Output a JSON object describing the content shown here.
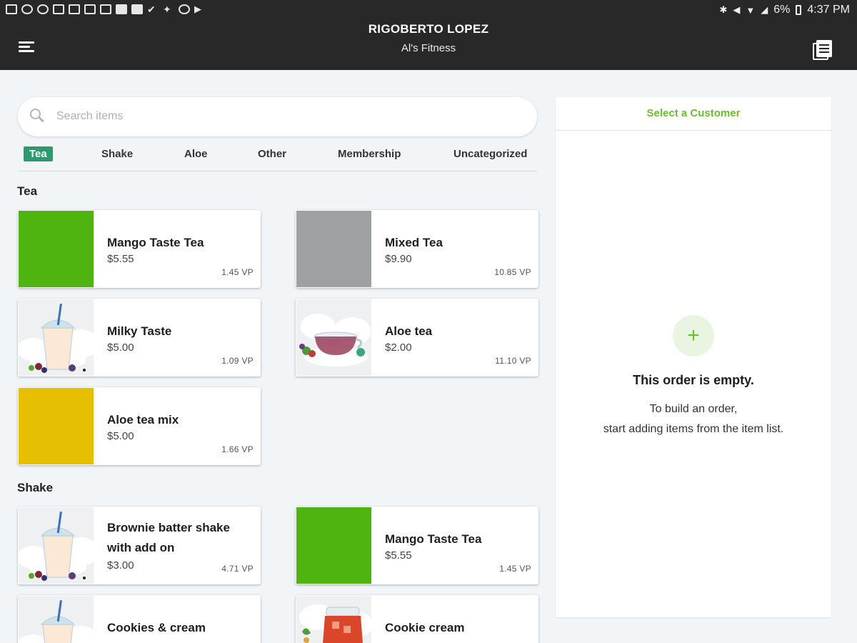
{
  "status_bar": {
    "battery": "6%",
    "time": "4:37 PM",
    "icons": [
      "gallery-icon",
      "chrome-icon",
      "chrome-icon",
      "gallery-icon",
      "image-icon",
      "shield-icon",
      "shield-icon",
      "flipboard-icon",
      "flipboard-icon",
      "check-icon",
      "bluetooth-icon",
      "vpn-icon",
      "play-icon"
    ]
  },
  "header": {
    "user_name": "RIGOBERTO LOPEZ",
    "business_name": "Al's Fitness"
  },
  "search": {
    "placeholder": "Search items"
  },
  "tabs": [
    "Tea",
    "Shake",
    "Aloe",
    "Other",
    "Membership",
    "Uncategorized"
  ],
  "active_tab": "Tea",
  "sections": {
    "tea": {
      "title": "Tea",
      "items": [
        {
          "name": "Mango Taste Tea",
          "price": "$5.55",
          "vp": "1.45 VP",
          "image": "green-swatch",
          "color": "#4fb410"
        },
        {
          "name": "Mixed Tea",
          "price": "$9.90",
          "vp": "10.85 VP",
          "image": "gray-swatch",
          "color": "#9ea1a3"
        },
        {
          "name": "Milky Taste",
          "price": "$5.00",
          "vp": "1.09 VP",
          "image": "shake-cup-photo"
        },
        {
          "name": "Aloe tea",
          "price": "$2.00",
          "vp": "11.10 VP",
          "image": "tea-cup-photo"
        },
        {
          "name": "Aloe tea mix",
          "price": "$5.00",
          "vp": "1.66 VP",
          "image": "yellow-swatch",
          "color": "#e6bf02"
        }
      ]
    },
    "shake": {
      "title": "Shake",
      "items": [
        {
          "name": "Brownie batter shake with add on",
          "price": "$3.00",
          "vp": "4.71 VP",
          "image": "shake-cup-photo"
        },
        {
          "name": "Mango Taste Tea",
          "price": "$5.55",
          "vp": "1.45 VP",
          "image": "green-swatch",
          "color": "#4fb410"
        },
        {
          "name": "Cookies & cream",
          "image": "shake-cup-photo"
        },
        {
          "name": "Cookie cream",
          "image": "iced-tea-pitcher-photo"
        }
      ]
    }
  },
  "order_panel": {
    "select_customer": "Select a Customer",
    "empty_title": "This order is empty.",
    "empty_line1": "To build an order,",
    "empty_line2": "start adding items from the item list."
  },
  "colors": {
    "header_bg": "#282828",
    "accent_green": "#6abf2f",
    "active_tab": "#2c9a6f"
  }
}
